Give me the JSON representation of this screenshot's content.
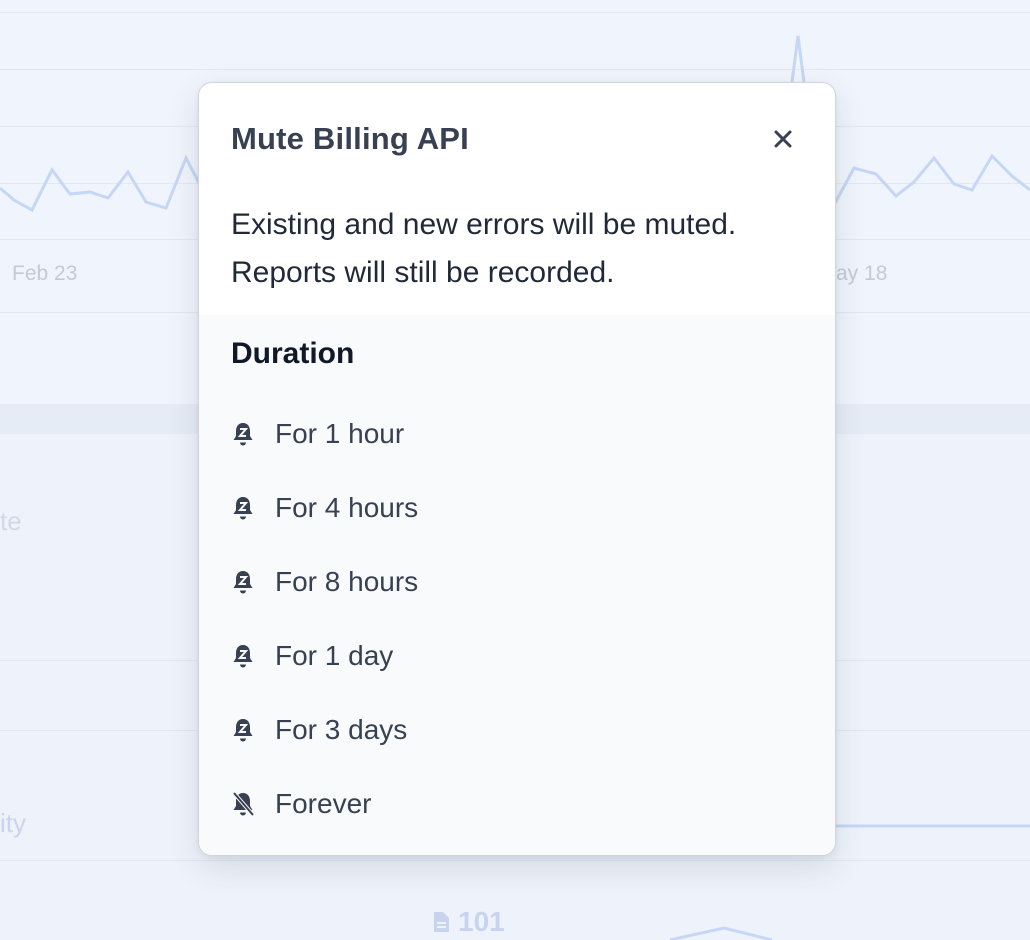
{
  "background": {
    "date_labels": [
      "Feb 23",
      "ay 18"
    ],
    "side_labels": [
      "te",
      "ity"
    ],
    "counter": "101"
  },
  "modal": {
    "title": "Mute Billing API",
    "description_lines": [
      "Existing and new errors will be muted.",
      "Reports will still be recorded."
    ],
    "close_icon": "close-icon",
    "section_heading": "Duration",
    "options": [
      {
        "label": "For 1 hour",
        "icon": "bell-snooze-icon"
      },
      {
        "label": "For 4 hours",
        "icon": "bell-snooze-icon"
      },
      {
        "label": "For 8 hours",
        "icon": "bell-snooze-icon"
      },
      {
        "label": "For 1 day",
        "icon": "bell-snooze-icon"
      },
      {
        "label": "For 3 days",
        "icon": "bell-snooze-icon"
      },
      {
        "label": "Forever",
        "icon": "bell-slash-icon"
      }
    ]
  },
  "colors": {
    "backdrop": "#eef3fb",
    "chart_line": "#c5d7f5",
    "modal_body": "#f9fafb",
    "text_primary": "#374151"
  }
}
